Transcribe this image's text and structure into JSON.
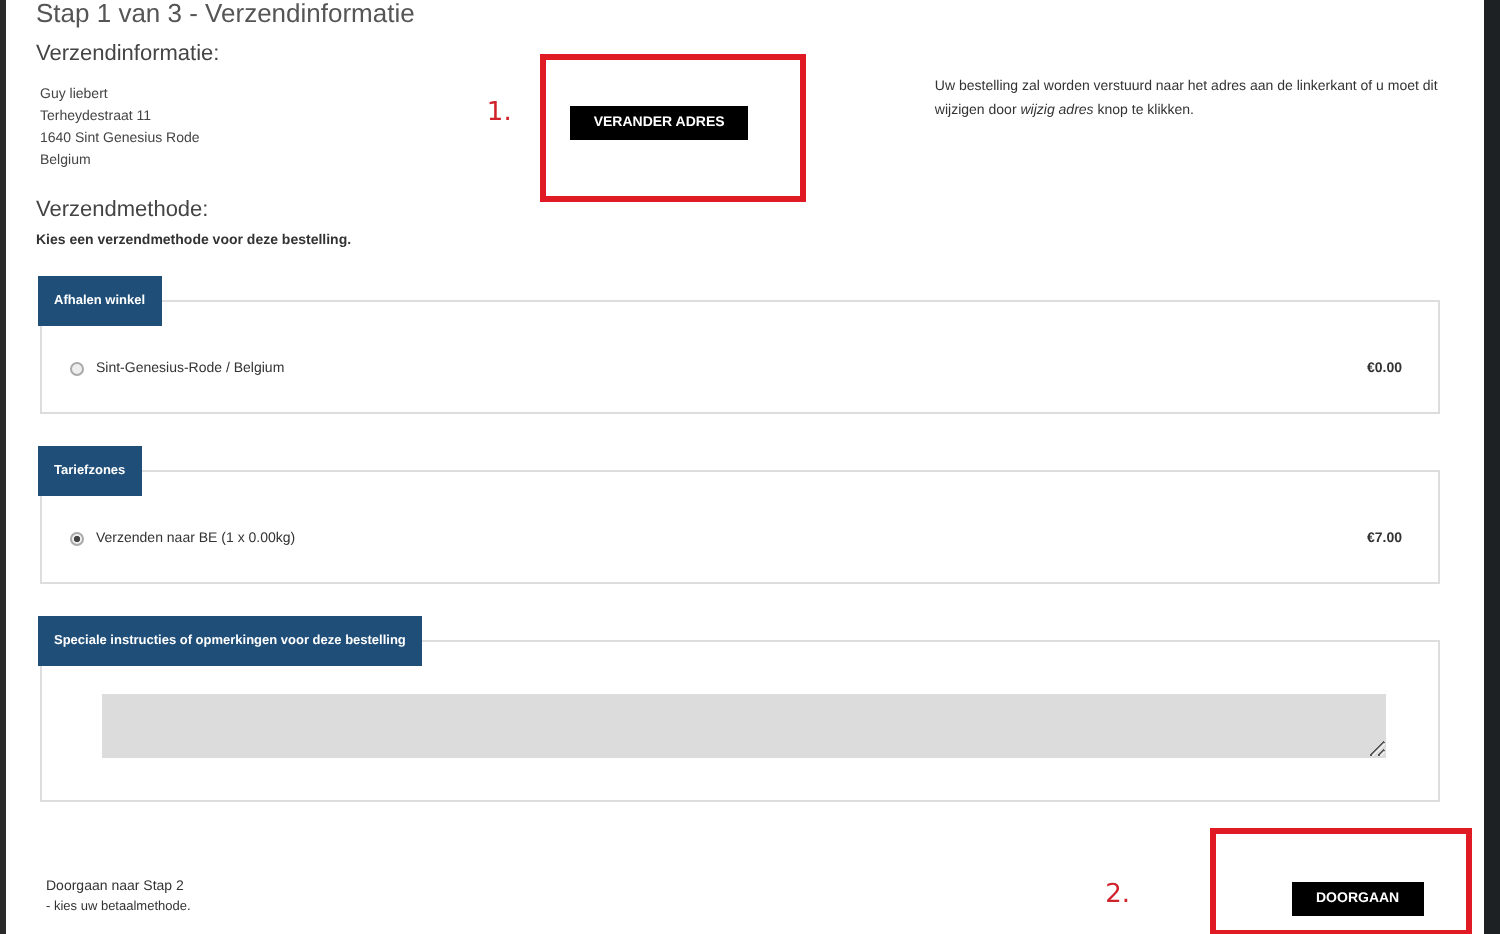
{
  "page_title": "Stap 1 van 3 - Verzendinformatie",
  "shipping_info": {
    "heading": "Verzendinformatie:",
    "address": [
      "Guy liebert",
      "Terheydestraat 11",
      "1640 Sint Genesius Rode",
      "Belgium"
    ],
    "button": "VERANDER ADRES",
    "annotation": "1.",
    "note": "Uw bestelling zal worden verstuurd naar het adres aan de linkerkant of u moet dit wijzigen door *wijzig adres* knop te klikken."
  },
  "shipping_method": {
    "heading": "Verzendmethode:",
    "instruction": "Kies een verzendmethode voor deze bestelling.",
    "groups": [
      {
        "title": "Afhalen winkel",
        "options": [
          {
            "label": "Sint-Genesius-Rode / Belgium",
            "price": "€0.00",
            "selected": false
          }
        ]
      },
      {
        "title": "Tariefzones",
        "options": [
          {
            "label": "Verzenden naar BE (1 x 0.00kg)",
            "price": "€7.00",
            "selected": true
          }
        ]
      }
    ]
  },
  "comments": {
    "title": "Speciale instructies of opmerkingen voor deze bestelling"
  },
  "footer": {
    "title": "Doorgaan naar Stap 2",
    "subtitle": "- kies uw betaalmethode.",
    "button": "DOORGAAN",
    "annotation": "2."
  }
}
